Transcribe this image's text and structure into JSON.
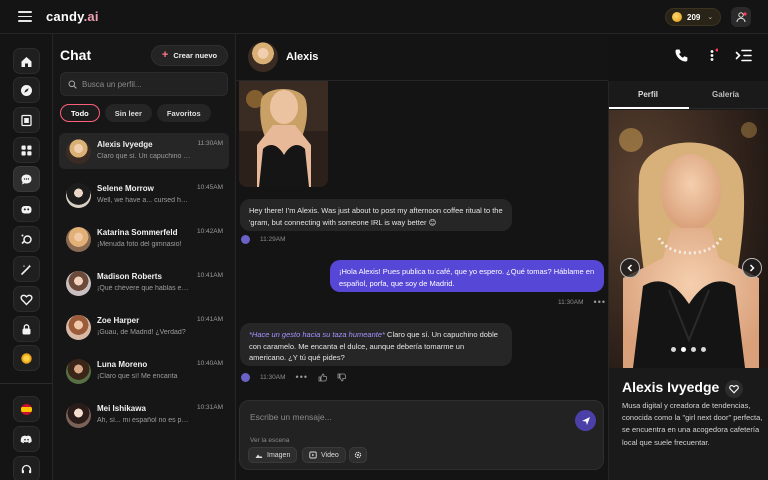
{
  "app": {
    "logo_main": "candy",
    "logo_tld": ".ai",
    "coins": "209"
  },
  "chatlist": {
    "title": "Chat",
    "new_chat": "Crear nuevo",
    "search_placeholder": "Busca un perfil...",
    "filters": [
      "Todo",
      "Sin leer",
      "Favoritos"
    ],
    "conversations": [
      {
        "name": "Alexis Ivyedge",
        "time": "11:30AM",
        "preview": "Claro que sí. Un capuchino doble con caramelo"
      },
      {
        "name": "Selene Morrow",
        "time": "10:45AM",
        "preview": "Well, we have a... cursed house"
      },
      {
        "name": "Katarina Sommerfeld",
        "time": "10:42AM",
        "preview": "¡Menuda foto del gimnasio!"
      },
      {
        "name": "Madison Roberts",
        "time": "10:41AM",
        "preview": "¡Qué chévere que hablas español!"
      },
      {
        "name": "Zoe Harper",
        "time": "10:41AM",
        "preview": "¡Guau, de Madrid! ¿Verdad?"
      },
      {
        "name": "Luna Moreno",
        "time": "10:40AM",
        "preview": "¡Claro que sí! Me encanta"
      },
      {
        "name": "Mei Ishikawa",
        "time": "10:31AM",
        "preview": "Ah, sí... mi español no es perfecto"
      }
    ]
  },
  "chat": {
    "contact_name": "Alexis",
    "messages": [
      {
        "dir": "in",
        "text": "Hey there! I'm Alexis. Was just about to post my afternoon coffee ritual to the 'gram, but connecting with someone IRL is way better 😊",
        "time": "11:29AM"
      },
      {
        "dir": "out",
        "text": "¡Hola Alexis! Pues publica tu café, que yo espero. ¿Qué tomas? Háblame en español, porfa, que soy de Madrid.",
        "time": "11:30AM"
      },
      {
        "dir": "in",
        "action": "*Hace un gesto hacia su taza humeante*",
        "text": " Claro que sí. Un capuchino doble con caramelo. Me encanta el dulce, aunque debería tomarme un americano. ¿Y tú qué pides?",
        "time": "11:30AM"
      }
    ],
    "composer_placeholder": "Escribe un mensaje...",
    "scene_label": "Ver la escena",
    "image_btn": "Imagen",
    "video_btn": "Video"
  },
  "profile": {
    "tab_profile": "Perfil",
    "tab_gallery": "Galería",
    "name": "Alexis Ivyedge",
    "bio": "Musa digital y creadora de tendencias, conocida como la \"girl next door\" perfecta, se encuentra en una acogedora cafetería local que suele frecuentar."
  },
  "colors": {
    "accent": "#5747d6",
    "chip_active": "#ff5f78",
    "action_text": "#a693ff"
  }
}
